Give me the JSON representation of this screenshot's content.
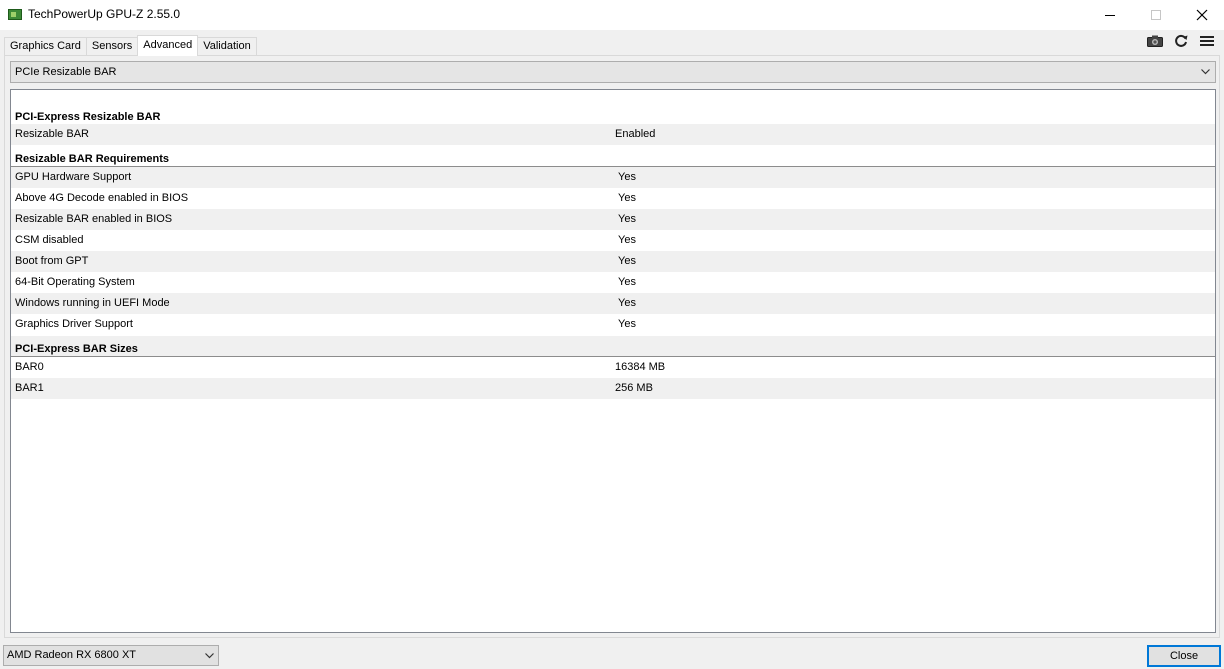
{
  "window": {
    "title": "TechPowerUp GPU-Z 2.55.0",
    "minimize": "—",
    "maximize": "☐",
    "close": "✕"
  },
  "tabs": [
    {
      "label": "Graphics Card",
      "active": false
    },
    {
      "label": "Sensors",
      "active": false
    },
    {
      "label": "Advanced",
      "active": true
    },
    {
      "label": "Validation",
      "active": false
    }
  ],
  "toolbar": {
    "icons": [
      "camera-icon",
      "refresh-icon",
      "menu-icon"
    ]
  },
  "section_select": {
    "value": "PCIe Resizable BAR"
  },
  "groups": {
    "resizable_bar": {
      "header": "PCI-Express Resizable BAR",
      "rows": [
        {
          "key": "Resizable BAR",
          "value": "Enabled"
        }
      ]
    },
    "requirements": {
      "header": "Resizable BAR Requirements",
      "rows": [
        {
          "key": "GPU Hardware Support",
          "value": "Yes"
        },
        {
          "key": "Above 4G Decode enabled in BIOS",
          "value": "Yes"
        },
        {
          "key": "Resizable BAR enabled in BIOS",
          "value": "Yes"
        },
        {
          "key": "CSM disabled",
          "value": "Yes"
        },
        {
          "key": "Boot from GPT",
          "value": "Yes"
        },
        {
          "key": "64-Bit Operating System",
          "value": "Yes"
        },
        {
          "key": "Windows running in UEFI Mode",
          "value": "Yes"
        },
        {
          "key": "Graphics Driver Support",
          "value": "Yes"
        }
      ]
    },
    "bar_sizes": {
      "header": "PCI-Express BAR Sizes",
      "rows": [
        {
          "key": "BAR0",
          "value": "16384 MB"
        },
        {
          "key": "BAR1",
          "value": "256 MB"
        }
      ]
    }
  },
  "footer": {
    "gpu_select": "AMD Radeon RX 6800 XT",
    "close_label": "Close"
  },
  "colors": {
    "accent": "#0078d7",
    "alt_row": "#f0f0f0",
    "app_icon": "#3d8a37"
  }
}
